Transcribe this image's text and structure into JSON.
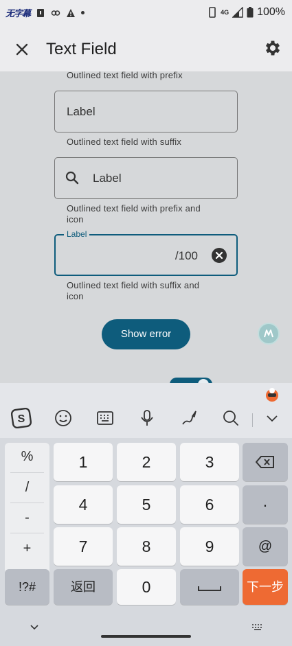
{
  "status_bar": {
    "app_badge": "无字幕",
    "network": "4G",
    "battery": "100%"
  },
  "app_bar": {
    "title": "Text Field",
    "close_icon": "close-icon",
    "settings_icon": "gear-icon"
  },
  "content": {
    "helper_prefix": "Outlined text field with prefix",
    "field1_label": "Label",
    "helper_suffix": "Outlined text field with suffix",
    "field2_label": "Label",
    "helper_prefix_icon": "Outlined text field with prefix and icon",
    "field3_label": "Label",
    "field3_suffix": "/100",
    "helper_suffix_icon": "Outlined text field with suffix and icon",
    "show_error": "Show error"
  },
  "keyboard": {
    "toolbar_icons": [
      "sogou-logo-icon",
      "emoji-icon",
      "keyboard-icon",
      "microphone-icon",
      "handwriting-icon",
      "search-icon",
      "chevron-down-icon"
    ],
    "side_keys": [
      "%",
      "/",
      "-",
      "+"
    ],
    "digits_row1": [
      "1",
      "2",
      "3"
    ],
    "digits_row2": [
      "4",
      "5",
      "6"
    ],
    "digits_row3": [
      "7",
      "8",
      "9"
    ],
    "dot": "·",
    "at": "@",
    "symbols": "!?#",
    "back": "返回",
    "zero": "0",
    "next": "下一步"
  }
}
